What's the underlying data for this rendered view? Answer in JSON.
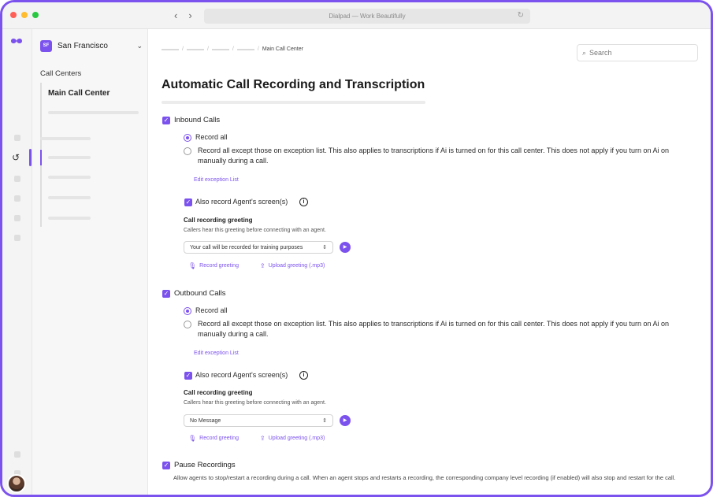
{
  "window": {
    "title": "Dialpad — Work Beautifully",
    "nav_back": "‹",
    "nav_forward": "›"
  },
  "colors": {
    "accent": "#7c52ee",
    "close": "#ff5f57",
    "minimize": "#febc2e",
    "zoom": "#28c840"
  },
  "sidebar": {
    "org_badge": "SF",
    "org_name": "San Francisco",
    "section_label": "Call Centers",
    "active_item": "Main Call Center"
  },
  "header": {
    "breadcrumb_current": "Main Call Center",
    "search_placeholder": "Search"
  },
  "page": {
    "title": "Automatic Call Recording and Transcription"
  },
  "inbound": {
    "label": "Inbound Calls",
    "record_all": "Record all",
    "record_except": "Record all except those on exception list. This also applies to transcriptions if Ai is turned on for this call center. This does not apply if you turn on Ai on manually during a call.",
    "edit_exception": "Edit exception List",
    "screen_record": "Also record Agent's screen(s)",
    "greeting_title": "Call recording greeting",
    "greeting_desc": "Callers hear this greeting before connecting with an agent.",
    "greeting_value": "Your call will be recorded for training purposes",
    "record_greeting": "Record greeting",
    "upload_greeting": "Upload greeting (.mp3)"
  },
  "outbound": {
    "label": "Outbound Calls",
    "record_all": "Record all",
    "record_except": "Record all except those on exception list. This also applies to transcriptions if Ai is turned on for this call center. This does not apply if you turn on Ai on manually during a call.",
    "edit_exception": "Edit exception List",
    "screen_record": "Also record Agent's screen(s)",
    "greeting_title": "Call recording greeting",
    "greeting_desc": "Callers hear this greeting before connecting with an agent.",
    "greeting_value": "No Message",
    "record_greeting": "Record greeting",
    "upload_greeting": "Upload greeting (.mp3)"
  },
  "pause": {
    "label": "Pause Recordings",
    "desc": "Allow agents to stop/restart a recording during a call. When an agent stops and restarts a recording, the corresponding company level recording (if enabled) will also stop and restart for the call."
  },
  "icons": {
    "checkbox": "✓",
    "info": "i",
    "play": "▶",
    "mic": "🎙",
    "upload": "⇪",
    "search": "⌕",
    "chevron": "⌄",
    "updown": "⇕",
    "history": "↺",
    "reload": "↻"
  }
}
